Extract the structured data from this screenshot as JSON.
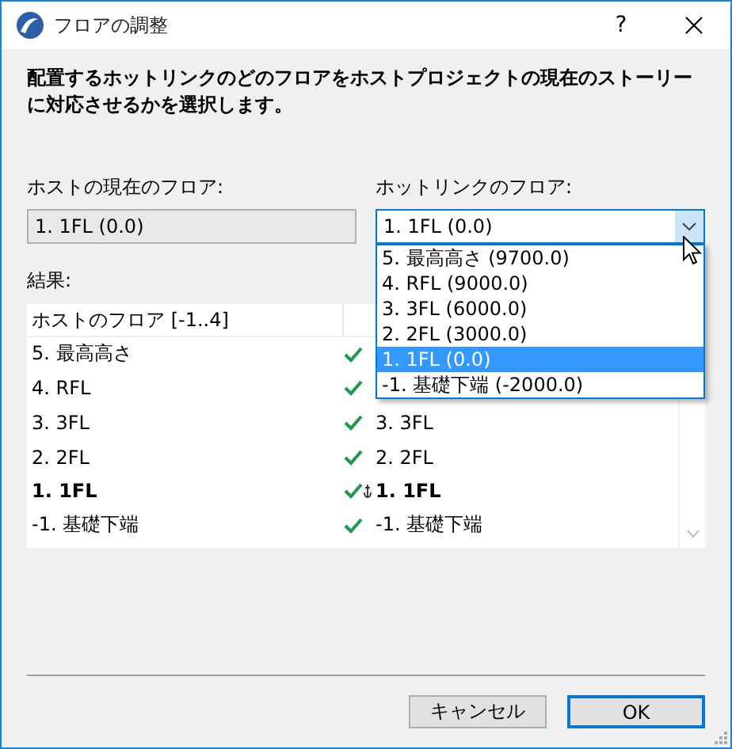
{
  "window": {
    "title": "フロアの調整",
    "help": "?"
  },
  "instruction": "配置するホットリンクのどのフロアをホストプロジェクトの現在のストーリーに対応させるかを選択します。",
  "host_floor": {
    "label": "ホストの現在のフロア:",
    "value": "1. 1FL (0.0)",
    "disabled": true
  },
  "link_floor": {
    "label": "ホットリンクのフロア:",
    "value": "1. 1FL (0.0)",
    "expanded": true,
    "options": [
      {
        "label": "5. 最高高さ (9700.0)",
        "selected": false
      },
      {
        "label": "4. RFL (9000.0)",
        "selected": false
      },
      {
        "label": "3. 3FL (6000.0)",
        "selected": false
      },
      {
        "label": "2. 2FL (3000.0)",
        "selected": false
      },
      {
        "label": "1. 1FL (0.0)",
        "selected": true
      },
      {
        "label": "-1. 基礎下端 (-2000.0)",
        "selected": false
      }
    ]
  },
  "results": {
    "label": "結果:",
    "header": "ホストのフロア [-1..4]",
    "rows": [
      {
        "host": "5. 最高高さ",
        "matched": true,
        "current": false
      },
      {
        "host": "4. RFL",
        "matched": true,
        "current": false
      },
      {
        "host": "3. 3FL",
        "matched": true,
        "current": false,
        "linked": "3. 3FL"
      },
      {
        "host": "2. 2FL",
        "matched": true,
        "current": false,
        "linked": "2. 2FL"
      },
      {
        "host": "1. 1FL",
        "matched": true,
        "current": true,
        "linked": "1. 1FL"
      },
      {
        "host": "-1. 基礎下端",
        "matched": true,
        "current": false,
        "linked": "-1. 基礎下端"
      }
    ]
  },
  "buttons": [
    {
      "label": "キャンセル",
      "default": false
    },
    {
      "label": "OK",
      "default": true
    }
  ]
}
